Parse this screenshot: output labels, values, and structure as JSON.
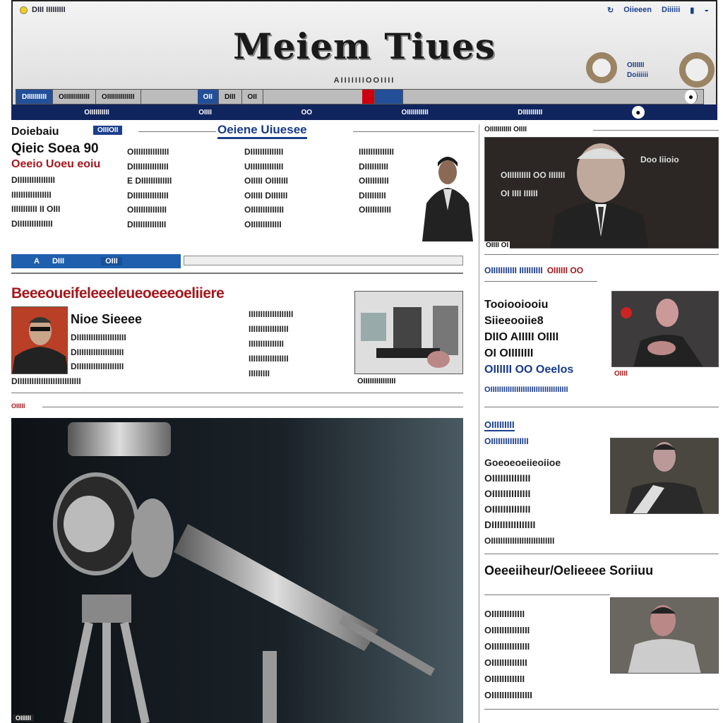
{
  "header": {
    "top_left": "DIII  IIIIIIIII",
    "top_right": [
      "Oiieeen",
      "Diiiiii"
    ],
    "logo": "Meiem Tiues",
    "tagline": "AIIIIIIIOOIIII",
    "links": [
      "OIIIIII",
      "Doiiiiii"
    ],
    "nav_items": [
      "DIIIIIIIIII",
      "OIIIIIIIIIIIII",
      "OIIIIIIIIIIIIII",
      "OII",
      "DIII",
      "OII"
    ],
    "nav2_items": [
      "OIIIIIIIIII",
      "OIIII",
      "OO",
      "OIIIIIIIIIII",
      "DIIIIIIIIII"
    ]
  },
  "lead": {
    "kicker": "Doiebaiu",
    "tag": "OIIIOII",
    "section_title": "Oeiene Uiuesee",
    "headline": "Qieic Soea 90",
    "subhead": "Oeeio Uoeu eoiu",
    "col1": [
      "DIIIIIIIIIIIIIIII",
      "IIIIIIIIIIIIIIIII",
      "IIIIIIIIIII II OIII",
      "DIIIIIIIIIIIIIII"
    ],
    "col2": [
      "OIIIIIIIIIIIIIII",
      "DIIIIIIIIIIIIIII",
      "E DIIIIIIIIIIIII",
      "DIIIIIIIIIIIIIII",
      "OIIIIIIIIIIIIII",
      "DIIIIIIIIIIIIII"
    ],
    "col3": [
      "DIIIIIIIIIIIIII",
      "UIIIIIIIIIIIIII",
      "OIIIII OIIIIIII",
      "OIIIII DIIIIIII",
      "OIIIIIIIIIIIIII",
      "OIIIIIIIIIIIII"
    ],
    "col4": [
      "IIIIIIIIIIIIIII",
      "DIIIIIIIIII",
      "OIIIIIIIIII",
      "DIIIIIIIII",
      "OIIIIIIIIIII"
    ],
    "tabs": [
      "A",
      "DIII",
      "OIII"
    ]
  },
  "second": {
    "headline": "Beeeoueifeleeeleueoeeeoeliiere",
    "name": "Nioe Sieeee",
    "body": [
      "DIIIIIIIIIIIIIIIIIIIII",
      "DIIIIIIIIIIIIIIIIIIII",
      "DIIIIIIIIIIIIIIIIIIII",
      "DIIIIIIIIIIIIIIIIIIIIIIIIIII"
    ],
    "col2": [
      "IIIIIIIIIIIIIIIIIII",
      "IIIIIIIIIIIIIIIII",
      "IIIIIIIIIIIIIII",
      "IIIIIIIIIIIIIIIII",
      "IIIIIIIII"
    ],
    "caption": "OIIIIIIIIIIIIIII",
    "marker": "OIIIII"
  },
  "big_photo": {
    "credit": "OIIIIII"
  },
  "right": {
    "small_top": "OIIIIIIIIIII OIIII",
    "featured_text": [
      "Doo Iiioio",
      "OIIIIIIIIII OO IIIIIII",
      "OI IIII IIIIII"
    ],
    "featured_caption": "OIIII OI",
    "row_links": "OIIIIIIIIIII IIIIIIIIII",
    "row_links_red": "OIIIIII OO",
    "story1_title": [
      "Tooiooiooiu",
      "Siieeooiie8",
      "DIIO AIIIII OIIII",
      "OI OIIIIIIII"
    ],
    "story1_blue": "OIIIIII OO Oeelos",
    "story1_meta": "OIIIIIIIIIIIIIIIIIIIIIIIIIIIIIIIIIIII",
    "story1_meta2": "OIIII",
    "section_tag": "OIIIIIIIII",
    "story2_blue": "OIIIIIIIIIIIIIIII",
    "story2_body": [
      "Goeoeoeiieoiioe",
      "OIIIIIIIIIIIIII",
      "OIIIIIIIIIIIIII",
      "OIIIIIIIIIIIIII",
      "DIIIIIIIIIIIIIIII",
      "OIIIIIIIIIIIIIIIIIIIIIIIIIII"
    ],
    "story3_title": "Oeeeiiheur/Oelieeee Soriiuu",
    "story3_body": [
      "OIIIIIIIIIIIII",
      "OIIIIIIIIIIIIIII",
      "OIIIIIIIIIIIIIII",
      "OIIIIIIIIIIIIII",
      "OIIIIIIIIIIIII",
      "OIIIIIIIIIIIIIIII"
    ]
  }
}
